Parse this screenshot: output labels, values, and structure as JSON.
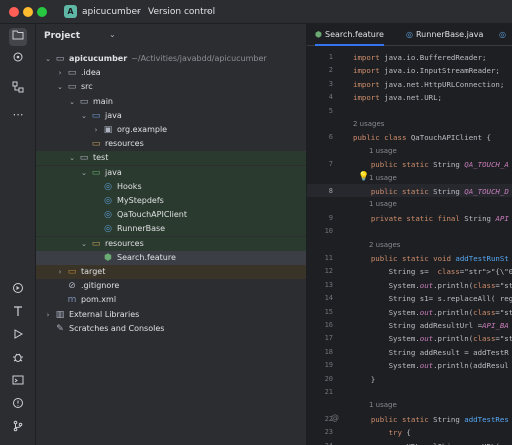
{
  "titlebar": {
    "project_badge": "A",
    "project_name": "apicucumber",
    "vcs_label": "Version control"
  },
  "activity_bar": {
    "top": [
      "folder-icon",
      "git-commit-icon",
      "structure-icon",
      "more-icon"
    ],
    "bottom": [
      "services-icon",
      "build-icon",
      "run-icon",
      "debug-icon",
      "terminal-icon",
      "problems-icon",
      "git-icon"
    ]
  },
  "project_panel": {
    "title": "Project",
    "tree": [
      {
        "label": "apicucumber",
        "path": "~/Activities/javabdd/apicucumber",
        "depth": 0,
        "arrow": "down",
        "icon": "folder"
      },
      {
        "label": ".idea",
        "depth": 1,
        "arrow": "right",
        "icon": "folder"
      },
      {
        "label": "src",
        "depth": 1,
        "arrow": "down",
        "icon": "folder"
      },
      {
        "label": "main",
        "depth": 2,
        "arrow": "down",
        "icon": "folder"
      },
      {
        "label": "java",
        "depth": 3,
        "arrow": "down",
        "icon": "folder-blue"
      },
      {
        "label": "org.example",
        "depth": 4,
        "arrow": "right",
        "icon": "package"
      },
      {
        "label": "resources",
        "depth": 3,
        "arrow": "none",
        "icon": "folder-res"
      },
      {
        "label": "test",
        "depth": 2,
        "arrow": "down",
        "icon": "folder"
      },
      {
        "label": "java",
        "depth": 3,
        "arrow": "down",
        "icon": "folder-green"
      },
      {
        "label": "Hooks",
        "depth": 4,
        "arrow": "none",
        "icon": "class"
      },
      {
        "label": "MyStepdefs",
        "depth": 4,
        "arrow": "none",
        "icon": "class"
      },
      {
        "label": "QaTouchAPIClient",
        "depth": 4,
        "arrow": "none",
        "icon": "class"
      },
      {
        "label": "RunnerBase",
        "depth": 4,
        "arrow": "none",
        "icon": "class"
      },
      {
        "label": "resources",
        "depth": 3,
        "arrow": "down",
        "icon": "folder-res"
      },
      {
        "label": "Search.feature",
        "depth": 4,
        "arrow": "none",
        "icon": "feature"
      },
      {
        "label": "target",
        "depth": 1,
        "arrow": "right",
        "icon": "folder-orange"
      },
      {
        "label": ".gitignore",
        "depth": 1,
        "arrow": "none",
        "icon": "gitignore"
      },
      {
        "label": "pom.xml",
        "depth": 1,
        "arrow": "none",
        "icon": "xml"
      },
      {
        "label": "External Libraries",
        "depth": 0,
        "arrow": "right",
        "icon": "library"
      },
      {
        "label": "Scratches and Consoles",
        "depth": 0,
        "arrow": "none",
        "icon": "scratch"
      }
    ]
  },
  "editor": {
    "tabs": [
      {
        "label": "Search.feature",
        "icon": "feature-icon"
      },
      {
        "label": "RunnerBase.java",
        "icon": "class-icon"
      },
      {
        "label": "",
        "icon": "class-icon"
      }
    ],
    "current_line": "8",
    "lines": [
      {
        "n": "1",
        "text": "import java.io.BufferedReader;"
      },
      {
        "n": "2",
        "text": "import java.io.InputStreamReader;"
      },
      {
        "n": "3",
        "text": "import java.net.HttpURLConnection;"
      },
      {
        "n": "4",
        "text": "import java.net.URL;"
      },
      {
        "n": "5",
        "text": ""
      },
      {
        "n": "",
        "hint": "2 usages"
      },
      {
        "n": "6",
        "text": "public class QaTouchAPIClient {"
      },
      {
        "n": "",
        "hint": "1 usage"
      },
      {
        "n": "7",
        "text": "    public static String QA_TOUCH_A"
      },
      {
        "n": "",
        "hint": "1 usage"
      },
      {
        "n": "8",
        "text": "    public static String QA_TOUCH_D"
      },
      {
        "n": "",
        "hint": "1 usage"
      },
      {
        "n": "9",
        "text": "    private static final String API"
      },
      {
        "n": "10",
        "text": ""
      },
      {
        "n": "",
        "hint": "2 usages"
      },
      {
        "n": "11",
        "text": "    public static void addTestRunSt"
      },
      {
        "n": "12",
        "text": "        String s=  \"{\\\"0\\\":{\\\"case\\"
      },
      {
        "n": "13",
        "text": "        System.out.println(\"s: \"+s)"
      },
      {
        "n": "14",
        "text": "        String s1= s.replaceAll( rege"
      },
      {
        "n": "15",
        "text": "        System.out.println(\"s1: \"+s"
      },
      {
        "n": "16",
        "text": "        String addResultUrl =API_BA"
      },
      {
        "n": "17",
        "text": "        System.out.println(\"Add Res"
      },
      {
        "n": "18",
        "text": "        String addResult = addTestR"
      },
      {
        "n": "19",
        "text": "        System.out.println(addResul"
      },
      {
        "n": "20",
        "text": "    }"
      },
      {
        "n": "21",
        "text": ""
      },
      {
        "n": "",
        "hint": "1 usage"
      },
      {
        "n": "22",
        "text": "    public static String addTestRes"
      },
      {
        "n": "23",
        "text": "        try {"
      },
      {
        "n": "24",
        "text": "            URL urlObj = new URL(ac"
      },
      {
        "n": "25",
        "text": "            HttpURLConnection conn"
      }
    ]
  }
}
